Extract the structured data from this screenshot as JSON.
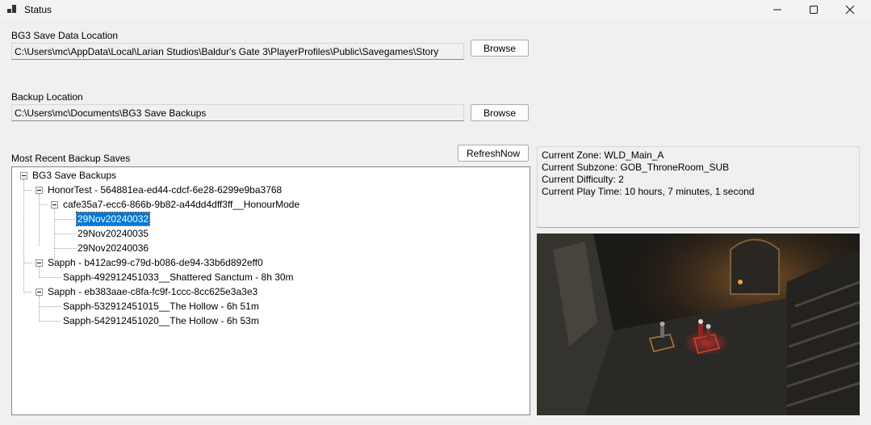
{
  "window": {
    "title": "Status",
    "icons": [
      "app-icon",
      "minimize-icon",
      "maximize-icon",
      "close-icon"
    ]
  },
  "save_location": {
    "label": "BG3 Save Data Location",
    "path": "C:\\Users\\mc\\AppData\\Local\\Larian Studios\\Baldur's Gate 3\\PlayerProfiles\\Public\\Savegames\\Story",
    "browse_label": "Browse"
  },
  "backup_location": {
    "label": "Backup Location",
    "path": "C:\\Users\\mc\\Documents\\BG3 Save Backups",
    "browse_label": "Browse"
  },
  "recent": {
    "label": "Most Recent Backup Saves",
    "refresh_label": "RefreshNow"
  },
  "tree": {
    "root": "BG3 Save Backups",
    "honor": {
      "label": "HonorTest - 564881ea-ed44-cdcf-6e28-6299e9ba3768",
      "mode": {
        "label": "cafe35a7-ecc6-866b-9b82-a44dd4dff3ff__HonourMode",
        "saves": [
          "29Nov20240032",
          "29Nov20240035",
          "29Nov20240036"
        ],
        "selected": "29Nov20240032"
      }
    },
    "sapph1": {
      "label": "Sapph - b412ac99-c79d-b086-de94-33b6d892eff0",
      "saves": [
        "Sapph-492912451033__Shattered Sanctum - 8h 30m"
      ]
    },
    "sapph2": {
      "label": "Sapph - eb383aae-c8fa-fc9f-1ccc-8cc625e3a3e3",
      "saves": [
        "Sapph-532912451015__The Hollow - 6h 51m",
        "Sapph-542912451020__The Hollow - 6h 53m"
      ]
    }
  },
  "status": {
    "zone": "Current Zone: WLD_Main_A",
    "subzone": "Current Subzone: GOB_ThroneRoom_SUB",
    "difficulty": "Current Difficulty: 2",
    "playtime": "Current Play Time: 10 hours, 7 minutes, 1 second"
  },
  "screenshot": {
    "description_icon": "game-screenshot",
    "colors": {
      "stone": "#3a3a36",
      "dark": "#0d0d0c",
      "fire": "#d8893a",
      "red_glow": "#c4281e"
    }
  }
}
